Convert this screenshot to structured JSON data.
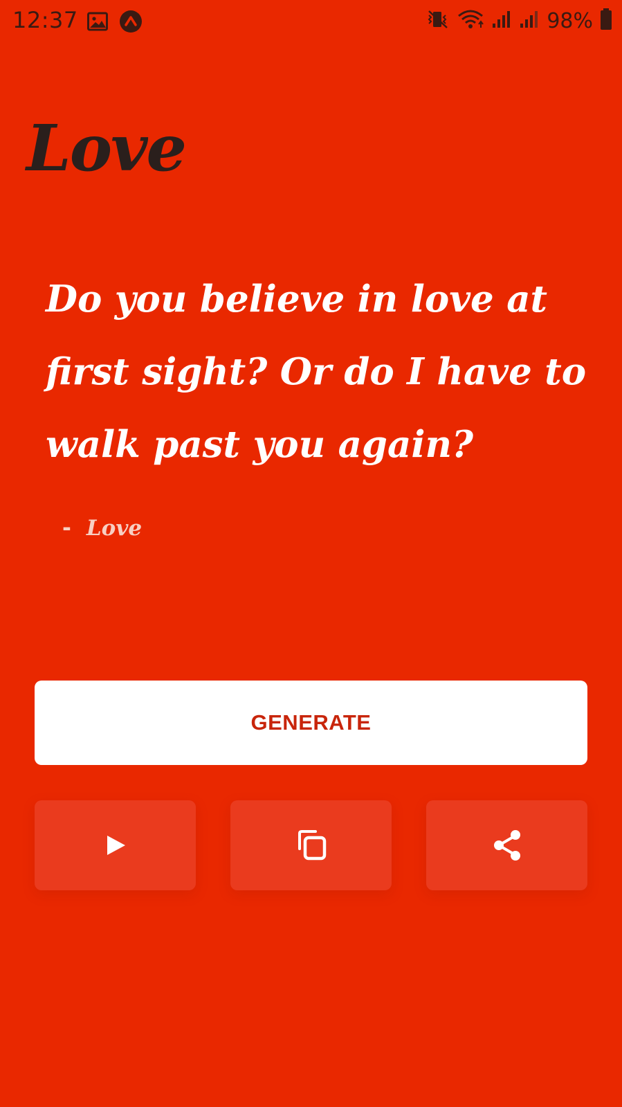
{
  "status_bar": {
    "time": "12:37",
    "battery": "98%",
    "icons": [
      "image-icon",
      "app-notification-icon",
      "vibrate-icon",
      "wifi-icon",
      "signal-icon",
      "signal-icon",
      "battery-icon"
    ]
  },
  "app": {
    "title": "Love"
  },
  "quote": {
    "text": "Do you believe in love at first sight? Or do I have to walk past you again?",
    "dash": "-",
    "author": "Love"
  },
  "buttons": {
    "generate_label": "GENERATE",
    "actions": [
      {
        "name": "play",
        "icon": "play-icon"
      },
      {
        "name": "copy",
        "icon": "copy-icon"
      },
      {
        "name": "share",
        "icon": "share-icon"
      }
    ]
  },
  "colors": {
    "background": "#e92800",
    "title": "#2a1f1c",
    "quote_text": "#ffffff",
    "author": "#f8cfc2",
    "generate_bg": "#ffffff",
    "generate_text": "#c8250b",
    "action_bg": "#ea3b1e"
  }
}
